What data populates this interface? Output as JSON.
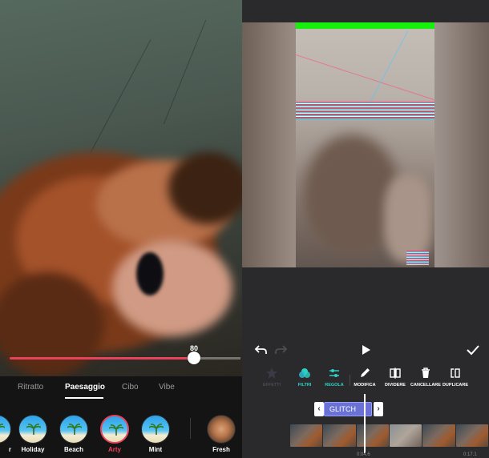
{
  "left_editor": {
    "intensity_value": "80",
    "intensity_level_percent": 80,
    "tabs": [
      {
        "label": "Ritratto",
        "active": false
      },
      {
        "label": "Paesaggio",
        "active": true
      },
      {
        "label": "Cibo",
        "active": false
      },
      {
        "label": "Vibe",
        "active": false
      }
    ],
    "filters": [
      {
        "label": "r",
        "selected": false
      },
      {
        "label": "Holiday",
        "selected": false
      },
      {
        "label": "Beach",
        "selected": false
      },
      {
        "label": "Arty",
        "selected": true
      },
      {
        "label": "Mint",
        "selected": false
      },
      {
        "label": "Fresh",
        "selected": false
      }
    ]
  },
  "right_editor": {
    "toolbar": [
      {
        "label": "EFFETTI",
        "icon": "star-icon"
      },
      {
        "label": "FILTRI",
        "icon": "filters-icon"
      },
      {
        "label": "REGOLA",
        "icon": "adjust-icon"
      },
      {
        "label": "MODIFICA",
        "icon": "pencil-icon"
      },
      {
        "label": "DIVIDERE",
        "icon": "split-icon"
      },
      {
        "label": "CANCELLARE",
        "icon": "trash-icon"
      },
      {
        "label": "DUPLICARE",
        "icon": "duplicate-icon"
      }
    ],
    "effect_clip_label": "GLITCH",
    "time_current": "0:04.6",
    "time_total": "0:17.1"
  },
  "colors": {
    "accent_pink": "#e8435a",
    "accent_cyan": "#2fd0c4",
    "effect_purple": "#6a72d6",
    "glitch_green": "#17f00d"
  }
}
